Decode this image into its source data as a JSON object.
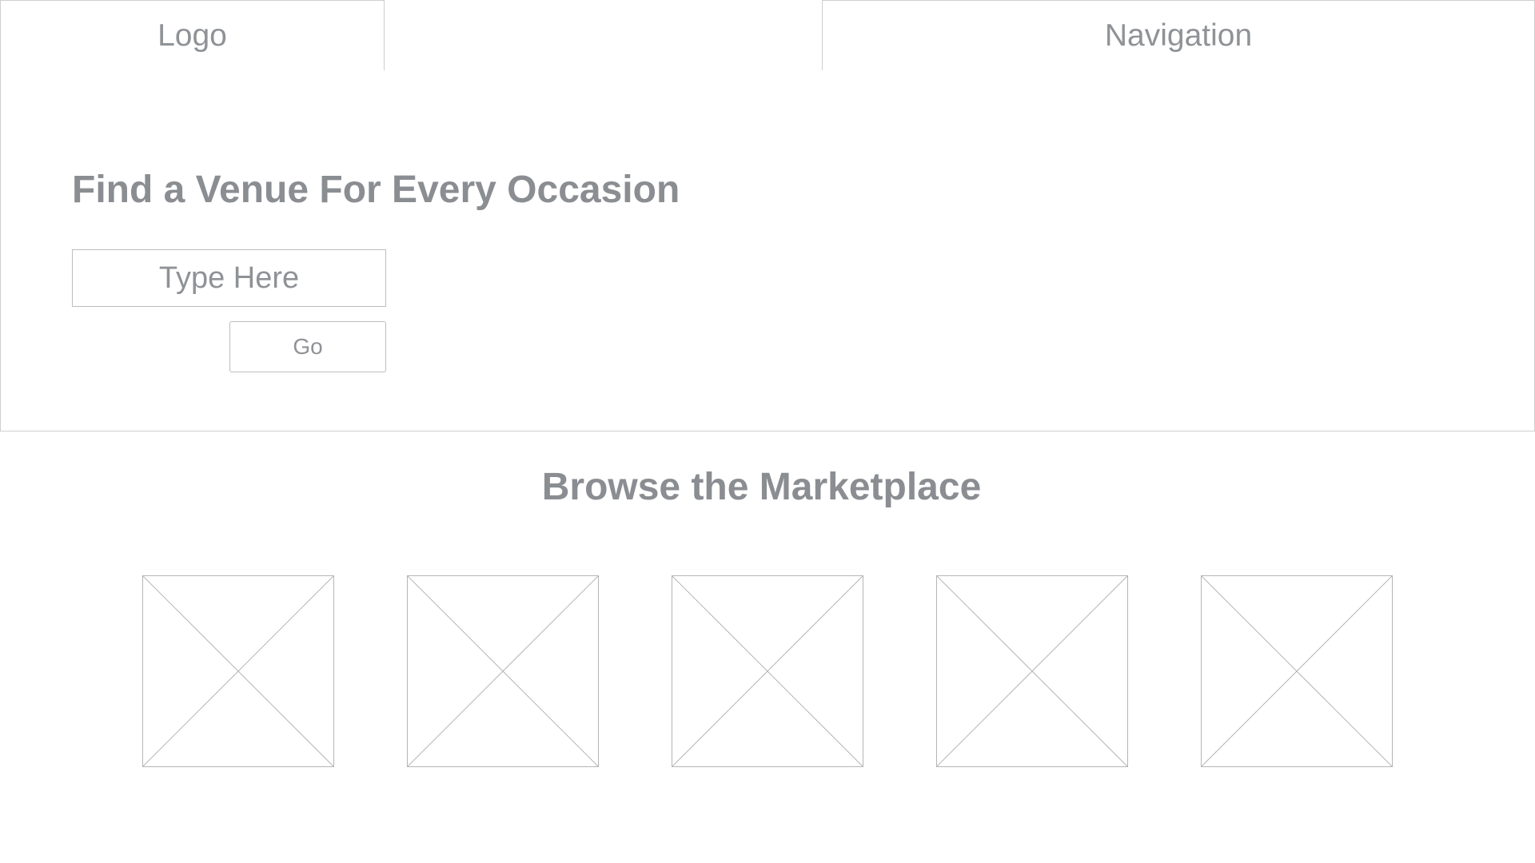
{
  "header": {
    "logo_label": "Logo",
    "navigation_label": "Navigation"
  },
  "hero": {
    "title": "Find a Venue For Every Occasion",
    "search_placeholder": "Type Here",
    "go_label": "Go"
  },
  "marketplace": {
    "title": "Browse the Marketplace",
    "tiles": [
      {
        "kind": "image-placeholder"
      },
      {
        "kind": "image-placeholder"
      },
      {
        "kind": "image-placeholder"
      },
      {
        "kind": "image-placeholder"
      },
      {
        "kind": "image-placeholder"
      }
    ]
  },
  "colors": {
    "text": "#8f9296",
    "border": "#cfcfcf",
    "background": "#ffffff"
  }
}
